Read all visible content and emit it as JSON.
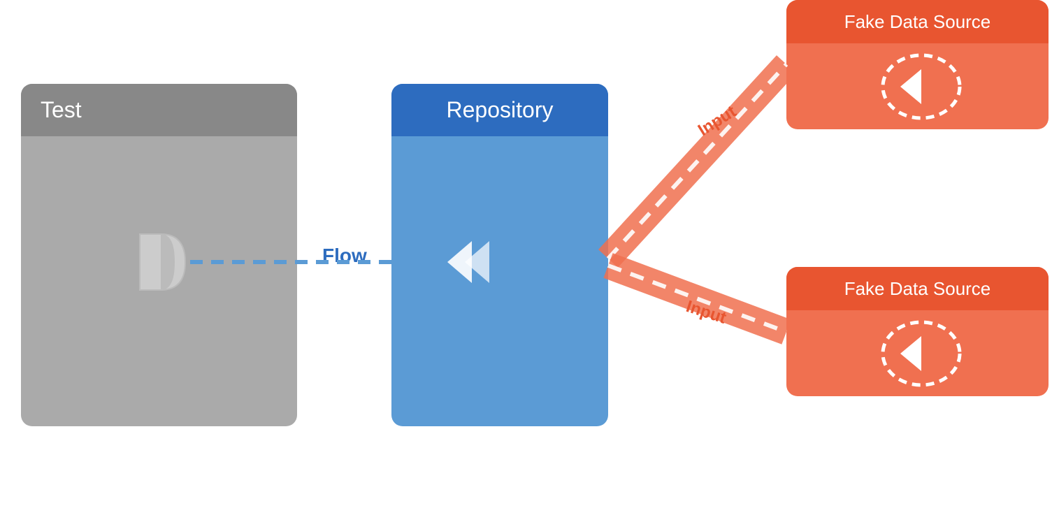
{
  "blocks": {
    "test": {
      "title": "Test"
    },
    "repository": {
      "title": "Repository"
    },
    "fds_top": {
      "title": "Fake Data Source",
      "input_label": "Input"
    },
    "fds_bottom": {
      "title": "Fake Data Source",
      "input_label": "Input"
    }
  },
  "labels": {
    "flow": "Flow"
  },
  "colors": {
    "test_header": "#888888",
    "test_body": "#aaaaaa",
    "repo_header": "#2d6cbf",
    "repo_body": "#5b9bd5",
    "fds_header": "#e85530",
    "fds_body": "#f07050",
    "flow_color": "#2d6cbf",
    "input_color": "#e85530",
    "dashed_line": "#5b9bd5",
    "arrow_fill": "white"
  }
}
